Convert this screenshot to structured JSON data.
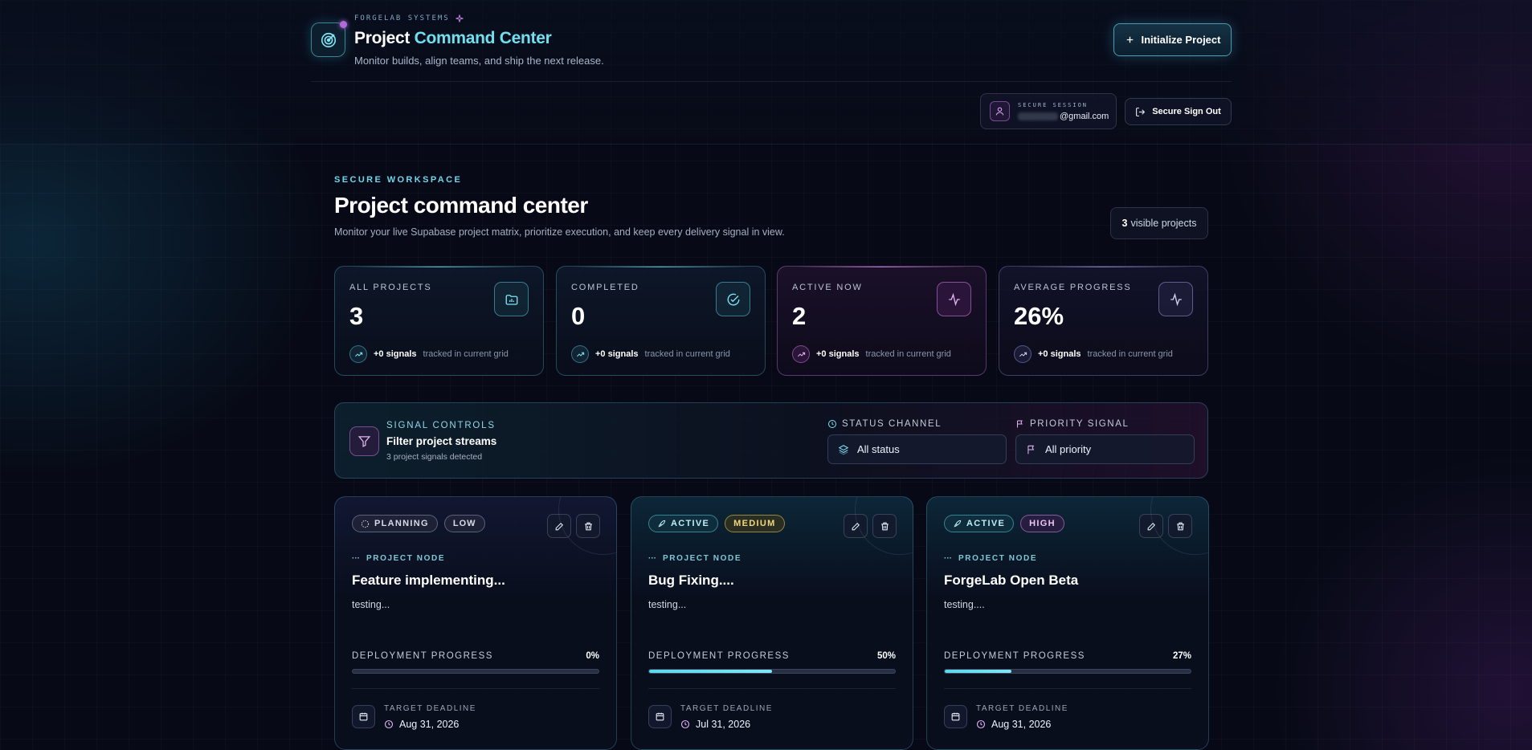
{
  "header": {
    "brand": "FORGELAB SYSTEMS",
    "title_main": "Project",
    "title_accent": "Command Center",
    "subtitle": "Monitor builds, align teams, and ship the next release.",
    "init_button": "Initialize Project",
    "session_label": "SECURE SESSION",
    "session_email": "@gmail.com",
    "signout_button": "Secure Sign Out"
  },
  "workspace": {
    "eyebrow": "SECURE WORKSPACE",
    "title": "Project command center",
    "subtitle": "Monitor your live Supabase project matrix, prioritize execution, and keep every delivery signal in view.",
    "visible_count": "3",
    "visible_label": "visible projects"
  },
  "stats": [
    {
      "label": "ALL PROJECTS",
      "value": "3",
      "signals": "+0 signals",
      "tracked": "tracked in current grid",
      "icon": "folder-chart-icon"
    },
    {
      "label": "COMPLETED",
      "value": "0",
      "signals": "+0 signals",
      "tracked": "tracked in current grid",
      "icon": "check-circle-icon"
    },
    {
      "label": "ACTIVE NOW",
      "value": "2",
      "signals": "+0 signals",
      "tracked": "tracked in current grid",
      "icon": "activity-icon"
    },
    {
      "label": "AVERAGE PROGRESS",
      "value": "26%",
      "signals": "+0 signals",
      "tracked": "tracked in current grid",
      "icon": "activity-icon"
    }
  ],
  "filters": {
    "label": "SIGNAL CONTROLS",
    "title": "Filter project streams",
    "subtitle": "3 project signals detected",
    "status_label": "STATUS CHANNEL",
    "status_value": "All status",
    "priority_label": "PRIORITY SIGNAL",
    "priority_value": "All priority"
  },
  "projects": [
    {
      "status": "PLANNING",
      "priority": "LOW",
      "node_label": "PROJECT NODE",
      "title": "Feature implementing...",
      "description": "testing...",
      "progress_label": "DEPLOYMENT PROGRESS",
      "progress_text": "0%",
      "progress": 0,
      "deadline_label": "TARGET DEADLINE",
      "deadline": "Aug 31, 2026"
    },
    {
      "status": "ACTIVE",
      "priority": "MEDIUM",
      "node_label": "PROJECT NODE",
      "title": "Bug Fixing....",
      "description": "testing...",
      "progress_label": "DEPLOYMENT PROGRESS",
      "progress_text": "50%",
      "progress": 50,
      "deadline_label": "TARGET DEADLINE",
      "deadline": "Jul 31, 2026"
    },
    {
      "status": "ACTIVE",
      "priority": "HIGH",
      "node_label": "PROJECT NODE",
      "title": "ForgeLab Open Beta",
      "description": "testing....",
      "progress_label": "DEPLOYMENT PROGRESS",
      "progress_text": "27%",
      "progress": 27,
      "deadline_label": "TARGET DEADLINE",
      "deadline": "Aug 31, 2026"
    }
  ],
  "colors": {
    "accent_cyan": "#6fe0f0",
    "accent_pink": "#c57ee0",
    "background": "#070a16",
    "medium_badge": "#f1d680"
  }
}
